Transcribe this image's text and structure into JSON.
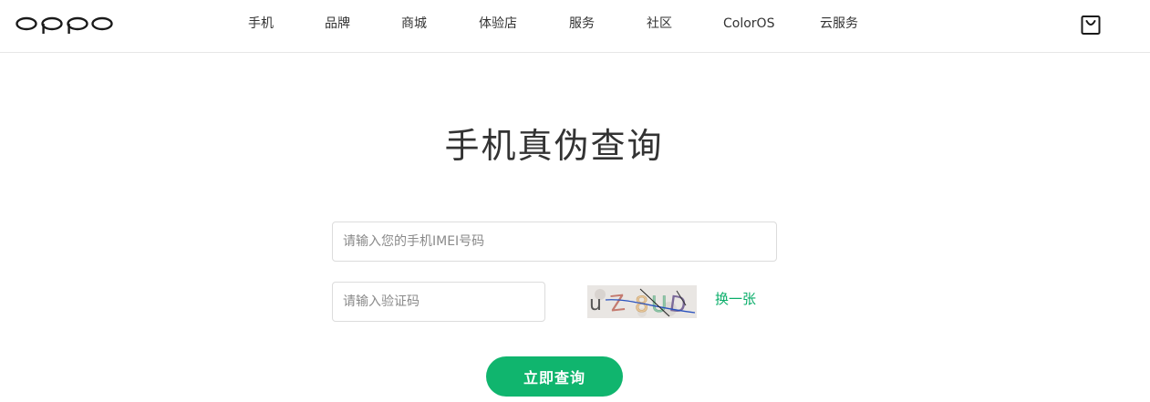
{
  "header": {
    "brand": "oppo",
    "nav": [
      {
        "label": "手机"
      },
      {
        "label": "品牌"
      },
      {
        "label": "商城"
      },
      {
        "label": "体验店"
      },
      {
        "label": "服务"
      },
      {
        "label": "社区"
      },
      {
        "label": "ColorOS"
      },
      {
        "label": "云服务"
      }
    ],
    "cart_icon": "shopping-bag-icon"
  },
  "main": {
    "title": "手机真伪查询",
    "imei_input": {
      "placeholder": "请输入您的手机IMEI号码",
      "value": ""
    },
    "code_input": {
      "placeholder": "请输入验证码",
      "value": ""
    },
    "captcha_text": "uZ8UD",
    "refresh_label": "换一张",
    "submit_label": "立即查询"
  },
  "colors": {
    "accent": "#10b56e",
    "link": "#0aae6a",
    "text": "#333333",
    "border": "#dcdcdc"
  }
}
